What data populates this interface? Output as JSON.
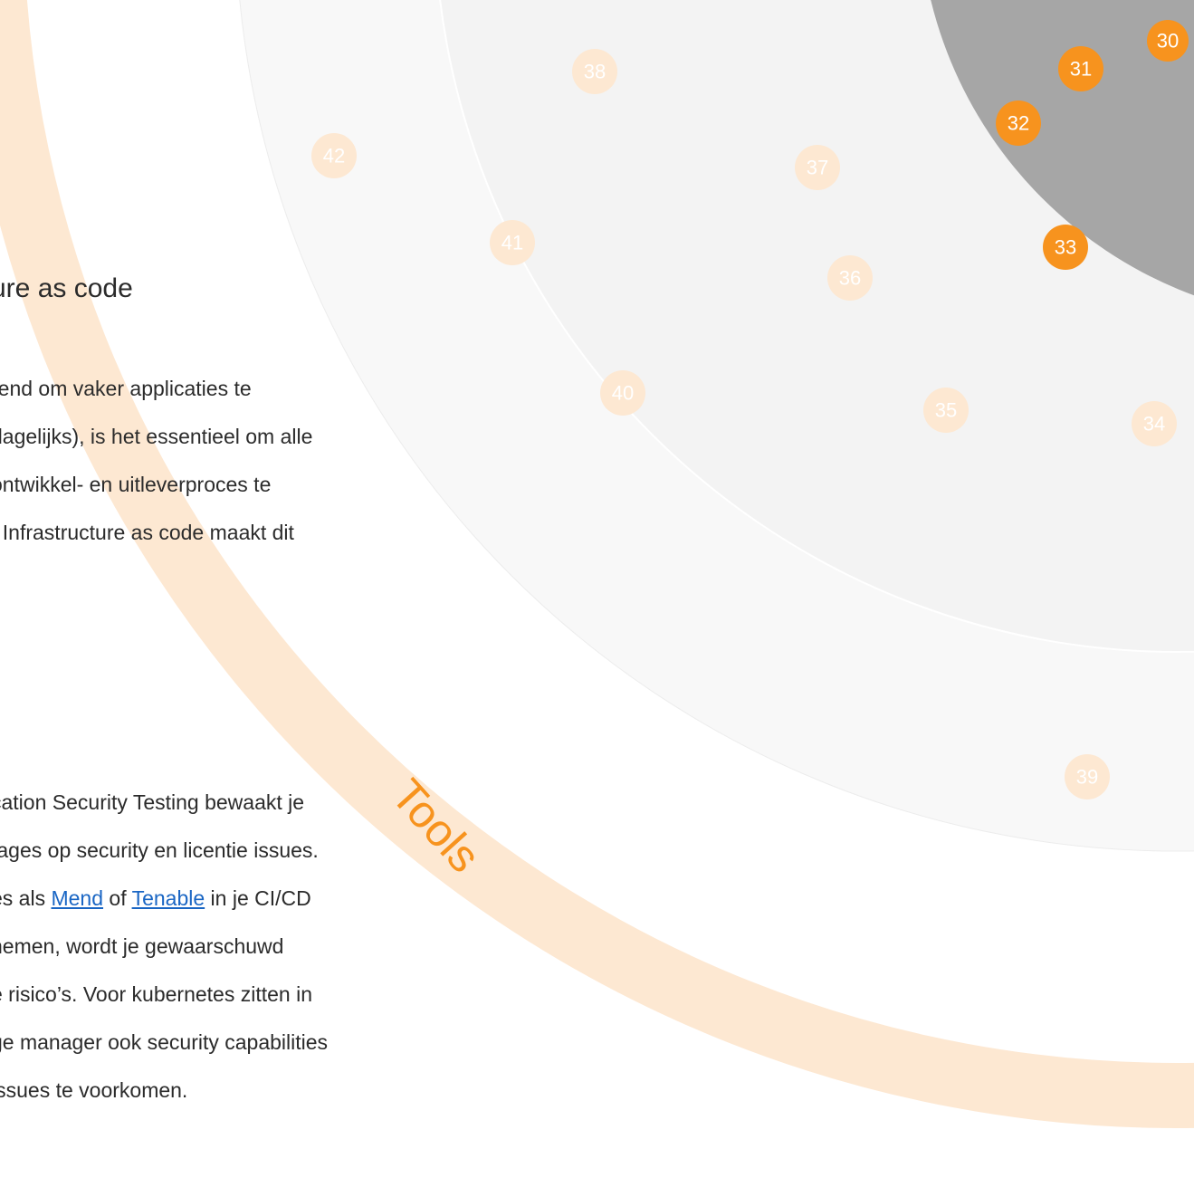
{
  "ring_label": "Tools",
  "section_title": "ure as code",
  "paragraph1": [
    "rend om vaker applicaties te",
    " dagelijks), is het essentieel om alle",
    " ontwikkel- en uitleverproces te",
    ". Infrastructure as code maakt dit"
  ],
  "paragraph2": {
    "line1": "cation Security Testing bewaakt je",
    "line2": "tages op security en licentie issues.",
    "line3_before": "es als ",
    "link_mend": "Mend",
    "line3_mid": " of ",
    "link_tenable": "Tenable",
    "line3_after": " in je CI/CD",
    "line4": "nemen, wordt je gewaarschuwd",
    "line5": "e risico’s. Voor kubernetes zitten in",
    "line6": "ge manager ook security capabilities",
    "line7": " issues te voorkomen."
  },
  "blips_active": [
    {
      "number": "30"
    },
    {
      "number": "31"
    },
    {
      "number": "32"
    },
    {
      "number": "33"
    }
  ],
  "blips_faded": [
    {
      "number": "34"
    },
    {
      "number": "35"
    },
    {
      "number": "36"
    },
    {
      "number": "37"
    },
    {
      "number": "38"
    },
    {
      "number": "39"
    },
    {
      "number": "40"
    },
    {
      "number": "41"
    },
    {
      "number": "42"
    }
  ],
  "colors": {
    "accent_orange": "#f7931e",
    "faded_orange": "#fde8d2",
    "ring_band": "#fde8d2",
    "core_gray": "#a6a6a6",
    "ring_gray_light": "#f3f3f3",
    "ring_gray_lighter": "#f8f8f8",
    "text_dark": "#2b2b2b",
    "link_blue": "#1a66c4"
  }
}
